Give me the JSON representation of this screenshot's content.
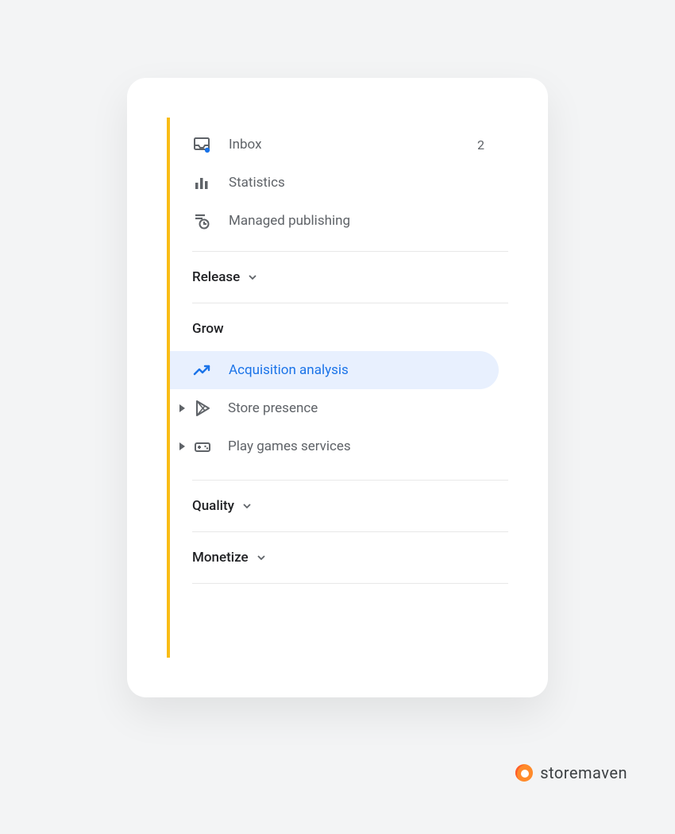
{
  "sidebar": {
    "top_items": [
      {
        "label": "Inbox",
        "count": "2"
      },
      {
        "label": "Statistics"
      },
      {
        "label": "Managed publishing"
      }
    ],
    "sections": {
      "release": {
        "label": "Release"
      },
      "grow": {
        "label": "Grow",
        "items": [
          {
            "label": "Acquisition analysis"
          },
          {
            "label": "Store presence"
          },
          {
            "label": "Play games services"
          }
        ]
      },
      "quality": {
        "label": "Quality"
      },
      "monetize": {
        "label": "Monetize"
      }
    }
  },
  "branding": {
    "name": "storemaven"
  },
  "colors": {
    "accent": "#1a73e8",
    "highlight_bg": "#e8f0fe",
    "sidebar_bar": "#f9bc15"
  }
}
